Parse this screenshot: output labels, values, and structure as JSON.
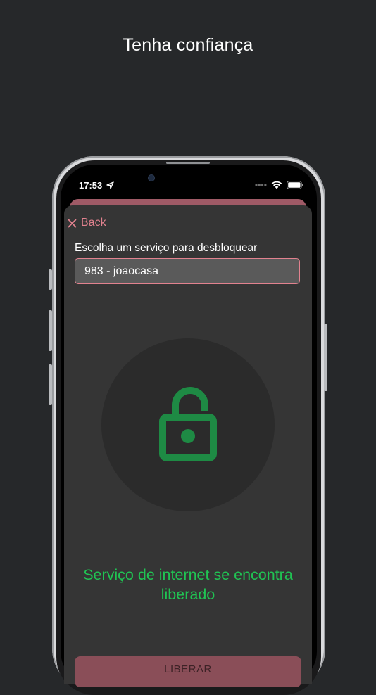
{
  "promo": {
    "headline": "Tenha confiança"
  },
  "status_bar": {
    "time": "17:53",
    "icons": [
      "location-arrow-icon",
      "signal-dots-icon",
      "wifi-icon",
      "battery-icon"
    ]
  },
  "nav": {
    "back_label": "Back",
    "back_icon": "close-icon"
  },
  "form": {
    "label": "Escolha um serviço para desbloquear",
    "selected_service": "983 - joaocasa"
  },
  "lock": {
    "icon": "unlocked-padlock-icon",
    "color": "#1e8a44"
  },
  "status_message": "Serviço de internet se encontra liberado",
  "action_button": {
    "label": "LIBERAR"
  },
  "colors": {
    "accent": "#e2828f",
    "success": "#20c453",
    "sheet_bg": "#353535",
    "page_bg": "#26282a"
  }
}
